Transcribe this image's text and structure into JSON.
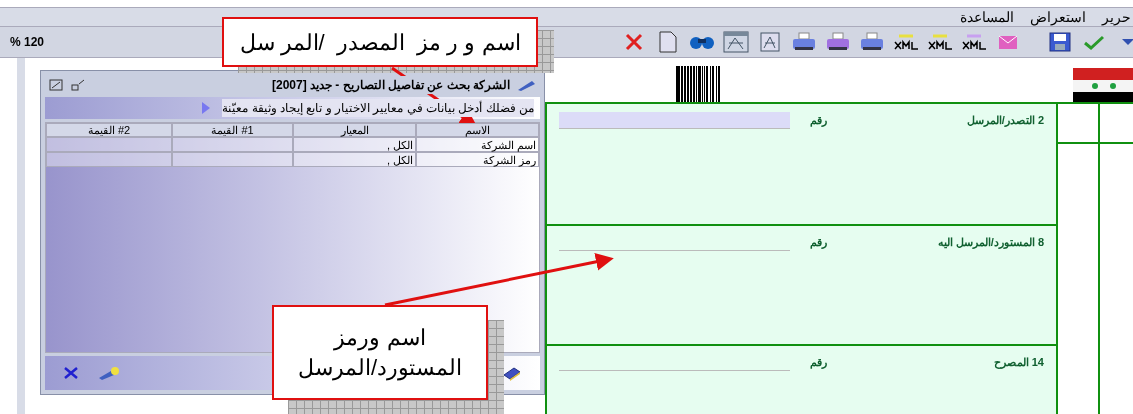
{
  "menu": [
    {
      "label": "حرير"
    },
    {
      "label": "استعراض"
    },
    {
      "label": "المساعدة"
    }
  ],
  "zoom": "% 120",
  "form_sections": [
    {
      "title": "2 التصدر/المرسل",
      "number_label": "رقم",
      "field_highlighted": true
    },
    {
      "title": "8 المستورد/المرسل اليه",
      "number_label": "رقم",
      "field_highlighted": false
    },
    {
      "title": "14 المصرح",
      "number_label": "رقم",
      "field_highlighted": false
    }
  ],
  "dialog": {
    "title": "الشركة بحث عن تفاصيل التصاريح - جديد [2007]",
    "instruction": "من فضلك أدخل بيانات في معايير الاختيار و تابع إيجاد وثيقة معيّنة",
    "table": {
      "columns": [
        "الاسم",
        "المعيار",
        "#1 القيمة",
        "#2 القيمة"
      ],
      "rows": [
        [
          "اسم الشركة",
          "الكل ,",
          "",
          ""
        ],
        [
          "رمز الشركة",
          "الكل ,",
          "",
          ""
        ]
      ]
    }
  },
  "callouts": [
    {
      "text": "اسم و ر مز  المصدر  /المر سل"
    },
    {
      "text": "اسم ورمز المستورد/المرسل"
    }
  ]
}
